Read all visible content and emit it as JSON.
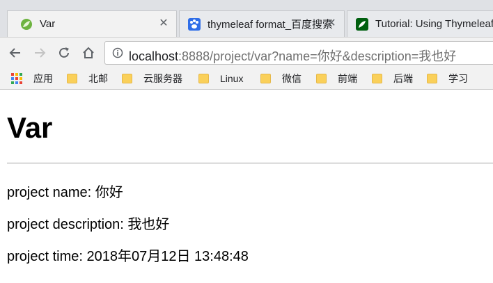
{
  "tabs": [
    {
      "title": "Var",
      "icon": "spring-leaf-icon"
    },
    {
      "title": "thymeleaf format_百度搜索",
      "icon": "baidu-paw-icon"
    },
    {
      "title": "Tutorial: Using Thymeleaf",
      "icon": "thymeleaf-leaf-icon"
    }
  ],
  "address_bar": {
    "host": "localhost",
    "path": ":8888/project/var?name=你好&description=我也好"
  },
  "bookmarks": {
    "apps_label": "应用",
    "folders": [
      "北邮",
      "云服务器",
      "Linux",
      "微信",
      "前端",
      "后端",
      "学习"
    ]
  },
  "page": {
    "heading": "Var",
    "name_line": "project name: 你好",
    "description_line": "project description: 我也好",
    "time_line": "project time: 2018年07月12日 13:48:48"
  },
  "colors": {
    "folder": "#fad05a",
    "tabstrip": "#dfe1e5",
    "toolbar": "#f2f2f2"
  }
}
